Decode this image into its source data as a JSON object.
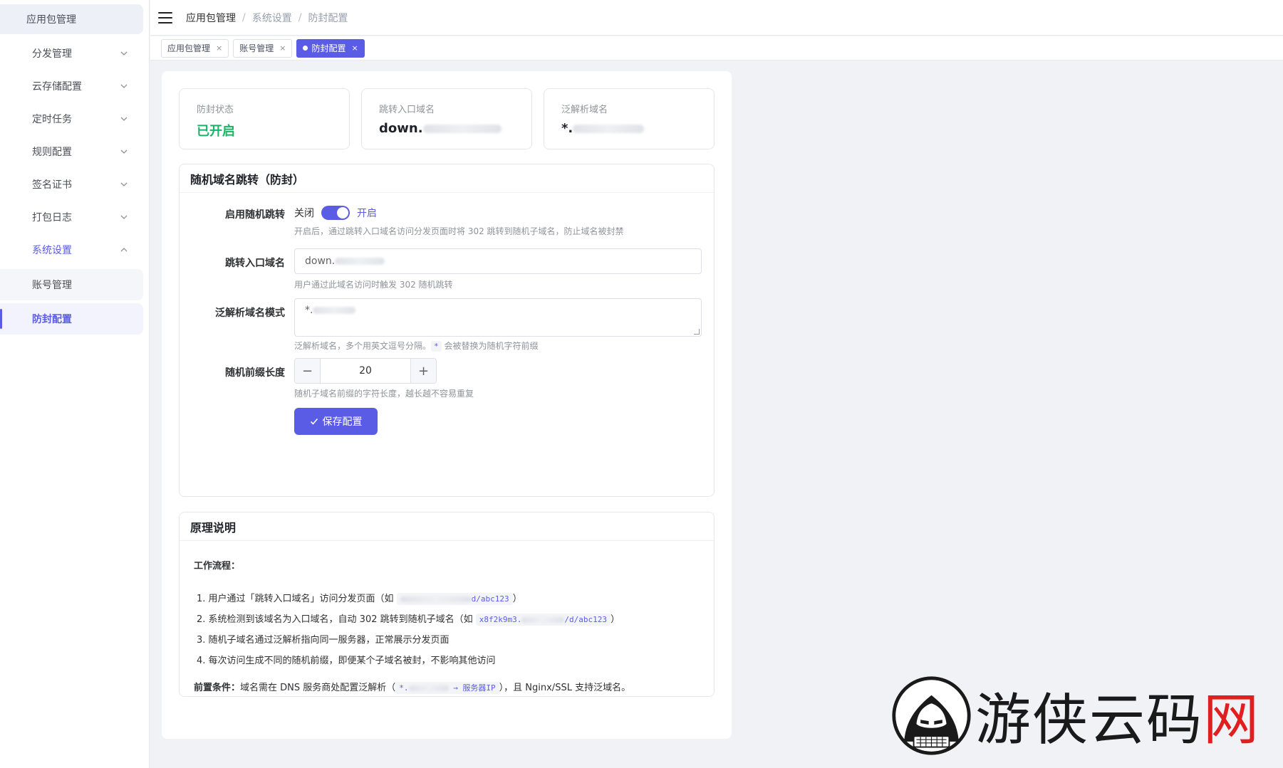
{
  "sidebar": {
    "top_item": "应用包管理",
    "items": [
      {
        "label": "分发管理"
      },
      {
        "label": "云存储配置"
      },
      {
        "label": "定时任务"
      },
      {
        "label": "规则配置"
      },
      {
        "label": "签名证书"
      },
      {
        "label": "打包日志"
      },
      {
        "label": "系统设置"
      }
    ],
    "sub_items": [
      {
        "label": "账号管理"
      },
      {
        "label": "防封配置"
      }
    ]
  },
  "breadcrumb": [
    "应用包管理",
    "系统设置",
    "防封配置"
  ],
  "breadcrumb_sep": "/",
  "tags": [
    {
      "label": "应用包管理",
      "close": "×"
    },
    {
      "label": "账号管理",
      "close": "×"
    },
    {
      "label": "防封配置",
      "close": "×"
    }
  ],
  "stats": [
    {
      "label": "防封状态",
      "value": "已开启"
    },
    {
      "label": "跳转入口域名",
      "value": "down."
    },
    {
      "label": "泛解析域名",
      "value": "*."
    }
  ],
  "form_card": {
    "title": "随机域名跳转（防封）",
    "enable": {
      "label": "启用随机跳转",
      "off_text": "关闭",
      "on_text": "开启",
      "checked": true,
      "hint": "开启后，通过跳转入口域名访问分发页面时将 302 跳转到随机子域名，防止域名被封禁"
    },
    "entry_domain": {
      "label": "跳转入口域名",
      "value": "down.",
      "hint": "用户通过此域名访问时触发 302 随机跳转"
    },
    "wildcard": {
      "label": "泛解析域名模式",
      "value": "*.",
      "hint_before": "泛解析域名，多个用英文逗号分隔。",
      "hint_code": "*",
      "hint_after": " 会被替换为随机字符前缀"
    },
    "prefix_len": {
      "label": "随机前缀长度",
      "value": "20",
      "minus": "−",
      "plus": "+",
      "hint": "随机子域名前缀的字符长度，越长越不容易重复"
    },
    "save_label": "保存配置"
  },
  "explain_card": {
    "title": "原理说明",
    "flow_title": "工作流程：",
    "steps": {
      "s1_before": "1. 用户通过「跳转入口域名」访问分发页面（如 ",
      "s1_code": "d/abc123",
      "s1_after": "）",
      "s2_before": "2. 系统检测到该域名为入口域名，自动 302 跳转到随机子域名（如 ",
      "s2_code_a": "x8f2k9m3.",
      "s2_code_b": "/d/abc123",
      "s2_after": "）",
      "s3": "3. 随机子域名通过泛解析指向同一服务器，正常展示分发页面",
      "s4": "4. 每次访问生成不同的随机前缀，即便某个子域名被封，不影响其他访问"
    },
    "pre_label": "前置条件：",
    "pre_before": "域名需在 DNS 服务商处配置泛解析（",
    "pre_code_a": "*.",
    "pre_code_b": "→ 服务器IP",
    "pre_after": "），且 Nginx/SSL 支持泛域名。"
  },
  "watermark": {
    "text_main": "游侠云码",
    "text_red": "网"
  },
  "colors": {
    "accent": "#5b5ce6",
    "success": "#18b566",
    "watermark_red": "#e02020"
  }
}
